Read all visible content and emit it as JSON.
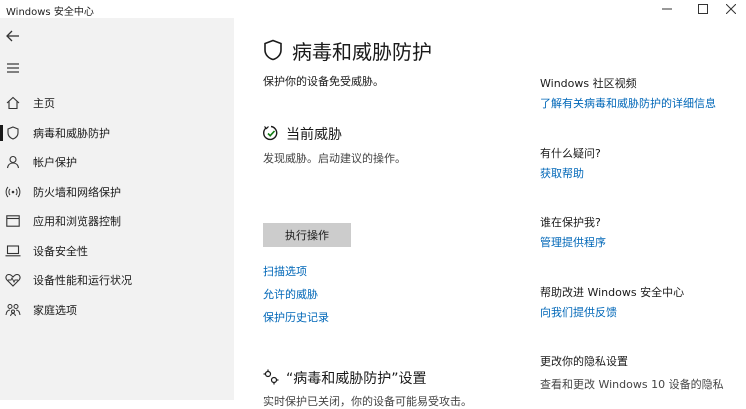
{
  "window": {
    "title": "Windows 安全中心"
  },
  "sidebar": {
    "items": [
      {
        "label": "主页"
      },
      {
        "label": "病毒和威胁防护"
      },
      {
        "label": "帐户保护"
      },
      {
        "label": "防火墙和网络保护"
      },
      {
        "label": "应用和浏览器控制"
      },
      {
        "label": "设备安全性"
      },
      {
        "label": "设备性能和运行状况"
      },
      {
        "label": "家庭选项"
      }
    ],
    "active_index": 1
  },
  "main": {
    "title": "病毒和威胁防护",
    "subtitle": "保护你的设备免受威胁。",
    "current_threats": {
      "title": "当前威胁",
      "description": "发现威胁。启动建议的操作。",
      "action_button": "执行操作",
      "links": [
        "扫描选项",
        "允许的威胁",
        "保护历史记录"
      ]
    },
    "settings_section": {
      "title": "“病毒和威胁防护”设置",
      "description": "实时保护已关闭，你的设备可能易受攻击。"
    }
  },
  "right": {
    "blocks": [
      {
        "heading": "Windows 社区视频",
        "link": "了解有关病毒和威胁防护的详细信息"
      },
      {
        "heading": "有什么疑问?",
        "link": "获取帮助"
      },
      {
        "heading": "谁在保护我?",
        "link": "管理提供程序"
      },
      {
        "heading": "帮助改进 Windows 安全中心",
        "link": "向我们提供反馈"
      },
      {
        "heading": "更改你的隐私设置",
        "text": "查看和更改 Windows 10 设备的隐私"
      }
    ]
  }
}
